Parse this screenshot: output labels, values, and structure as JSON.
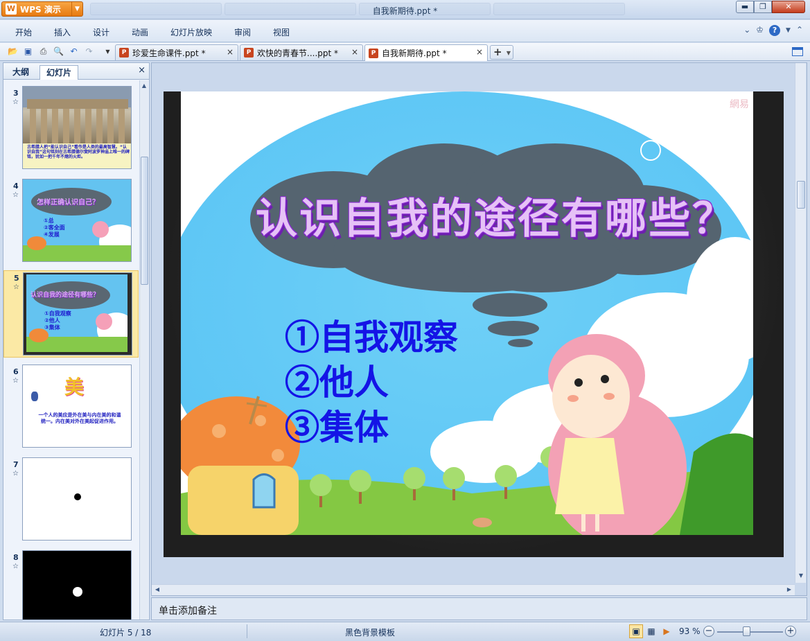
{
  "app": {
    "button_label": "WPS 演示",
    "window_title": "自我新期待.ppt *"
  },
  "menu": [
    "开始",
    "插入",
    "设计",
    "动画",
    "幻灯片放映",
    "审阅",
    "视图"
  ],
  "doc_tabs": [
    {
      "label": "珍爱生命课件.ppt *"
    },
    {
      "label": "欢快的青春节....ppt *"
    },
    {
      "label": "自我新期待.ppt *"
    }
  ],
  "panel": {
    "tabs": [
      "大纲",
      "幻灯片"
    ],
    "close": "×"
  },
  "thumbnails": [
    {
      "num": "3",
      "star": "☆",
      "caption": "古希腊人把“能认识自己”看作是人类的最高智慧。“认识自我”这句铭刻在古希腊德尔斐阿波罗神庙上唯一的碑铭，犹如一把千年不熄的火炬。"
    },
    {
      "num": "4",
      "star": "☆",
      "title": "怎样正确认识自己？",
      "items": [
        "①总",
        "②客全面",
        "④发展"
      ]
    },
    {
      "num": "5",
      "star": "☆",
      "title": "认识自我的途径有哪些？",
      "items": [
        "①自我观察",
        "②他人",
        "③集体"
      ]
    },
    {
      "num": "6",
      "star": "☆",
      "glyph": "美",
      "caption": "一个人的美应是外在美与内在美的和谐统一。内在美对外在美起促进作用。"
    },
    {
      "num": "7",
      "star": "☆"
    },
    {
      "num": "8",
      "star": "☆"
    }
  ],
  "slide": {
    "title": "认识自我的途径有哪些？",
    "items": [
      "①自我观察",
      "②他人",
      "③集体"
    ],
    "watermark": "網易"
  },
  "notes": {
    "placeholder": "单击添加备注"
  },
  "status": {
    "slide_position": "幻灯片 5 / 18",
    "template": "黑色背景模板",
    "zoom": "93 %"
  }
}
